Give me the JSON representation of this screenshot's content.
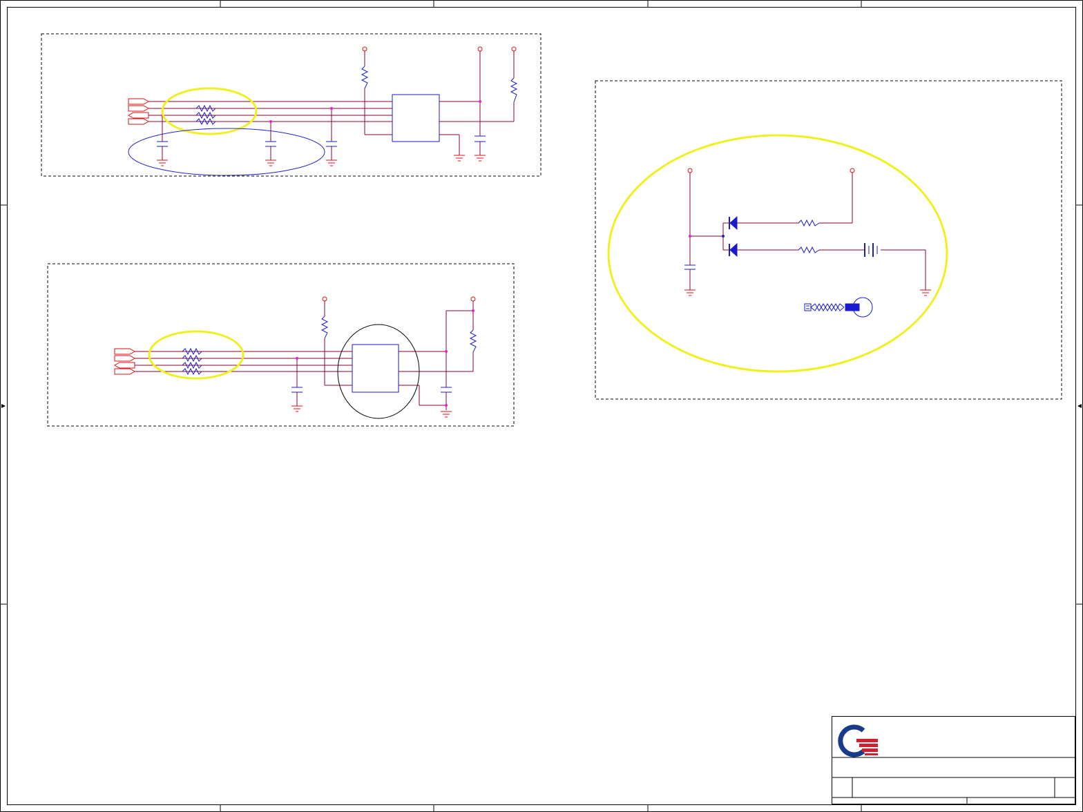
{
  "sheet": {
    "title_block": {
      "company_name": "",
      "title": "",
      "size": "",
      "document_number": "",
      "rev": "",
      "date": "",
      "sheet_of": ""
    }
  },
  "colors": {
    "wire": "#8b0030",
    "component": "#1a1acc",
    "power": "#dd1111",
    "junction": "#e020e0",
    "highlight_yellow": "#f0f020",
    "highlight_blue": "#2222cc",
    "highlight_black": "#000000",
    "logo_blue": "#1a3a8a",
    "logo_red": "#d02030"
  },
  "icons": {
    "logo": "company-logo",
    "ground": "ground-symbol",
    "power": "power-port",
    "resistor": "resistor-symbol",
    "capacitor": "capacitor-symbol",
    "diode": "diode-symbol",
    "battery": "battery-symbol",
    "crystal": "crystal-symbol",
    "offpage": "offpage-connector"
  }
}
